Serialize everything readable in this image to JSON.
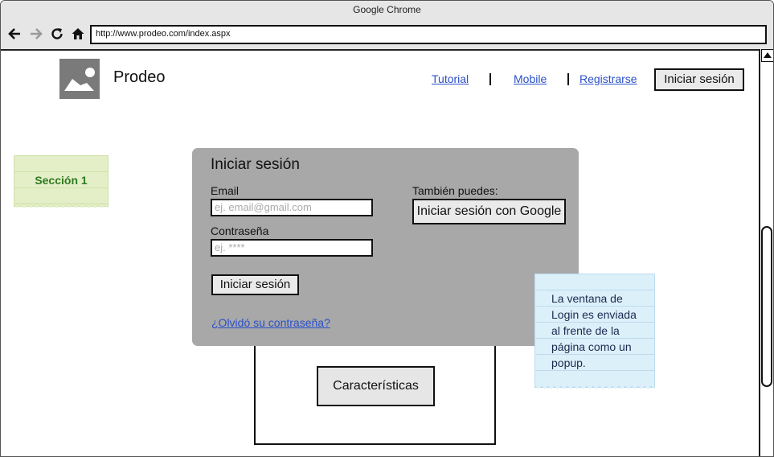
{
  "window": {
    "title": "Google Chrome"
  },
  "browser": {
    "url": "http://www.prodeo.com/index.aspx",
    "icons": [
      "back-arrow-icon",
      "forward-arrow-icon",
      "reload-icon",
      "home-icon"
    ]
  },
  "header": {
    "brand": "Prodeo",
    "logo_icon": "image-placeholder-icon",
    "nav": [
      "Tutorial",
      "Mobile",
      "Registrarse"
    ],
    "login_button": "Iniciar sesión"
  },
  "section_note": {
    "label": "Sección 1"
  },
  "login_popup": {
    "title": "Iniciar sesión",
    "email_label": "Email",
    "email_placeholder": "ej. email@gmail.com",
    "password_label": "Contraseña",
    "password_placeholder": "ej. ****",
    "submit_label": "Iniciar sesión",
    "also_label": "También puedes:",
    "google_button": "Iniciar sesión con Google",
    "forgot_link": "¿Olvidó su contraseña?"
  },
  "features": {
    "button_label": "Características"
  },
  "comment_note": {
    "text": "La ventana de Login es enviada al frente de la página como un popup."
  },
  "colors": {
    "link": "#2b50c8",
    "popup_bg": "#a8a8a8",
    "note_green": "#e4efc8",
    "note_blue": "#dcf0fa",
    "note_green_text": "#2e7a1e"
  }
}
